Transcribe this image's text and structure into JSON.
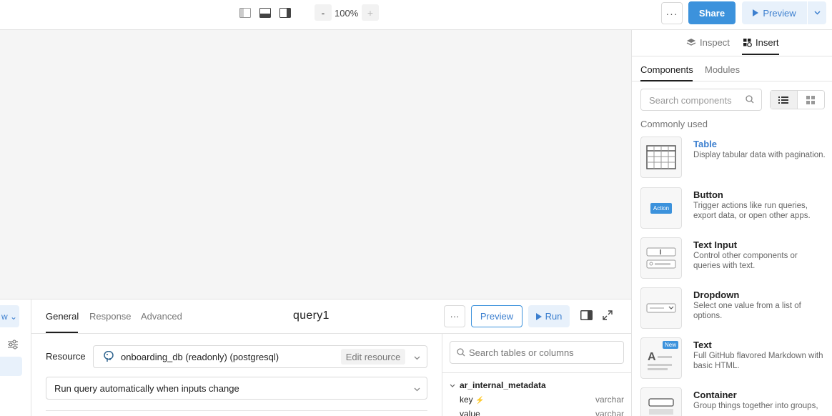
{
  "topbar": {
    "layout_icons": [
      "left-panel-icon",
      "bottom-panel-icon",
      "right-panel-icon"
    ],
    "zoom_minus": "-",
    "zoom_level": "100%",
    "zoom_plus": "+",
    "more": "···",
    "share_label": "Share",
    "preview_label": "Preview"
  },
  "query": {
    "tabs": [
      "General",
      "Response",
      "Advanced"
    ],
    "active_tab": "General",
    "name": "query1",
    "more": "···",
    "preview_label": "Preview",
    "run_label": "Run",
    "resource_label": "Resource",
    "resource_value": "onboarding_db (readonly) (postgresql)",
    "edit_resource_label": "Edit resource",
    "trigger_value": "Run query automatically when inputs change"
  },
  "schema": {
    "search_placeholder": "Search tables or columns",
    "table_name": "ar_internal_metadata",
    "columns": [
      {
        "name": "key",
        "type": "varchar"
      },
      {
        "name": "value",
        "type": "varchar"
      }
    ]
  },
  "sidebar": {
    "tab_inspect": "Inspect",
    "tab_insert": "Insert",
    "sub_components": "Components",
    "sub_modules": "Modules",
    "search_placeholder": "Search components",
    "section_title": "Commonly used",
    "components": [
      {
        "title": "Table",
        "desc": "Display tabular data with pagination."
      },
      {
        "title": "Button",
        "desc": "Trigger actions like run queries, export data, or open other apps.",
        "thumb_label": "Action"
      },
      {
        "title": "Text Input",
        "desc": "Control other components or queries with text."
      },
      {
        "title": "Dropdown",
        "desc": "Select one value from a list of options."
      },
      {
        "title": "Text",
        "desc": "Full GitHub flavored Markdown with basic HTML.",
        "badge": "New"
      },
      {
        "title": "Container",
        "desc": "Group things together into groups,"
      }
    ]
  },
  "colors": {
    "accent": "#3c92dc",
    "accent_light": "#e8f1fb",
    "canvas": "#f5f5f5"
  }
}
